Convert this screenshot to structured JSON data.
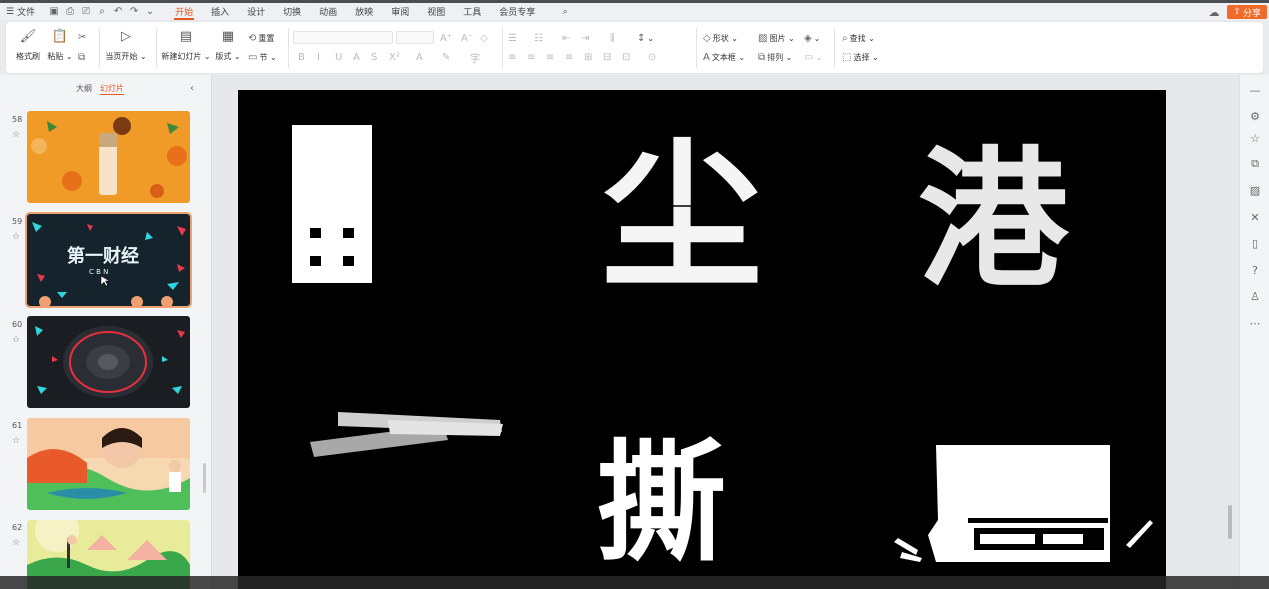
{
  "menubar": {
    "file_label": "文件",
    "tabs": [
      "开始",
      "插入",
      "设计",
      "切换",
      "动画",
      "放映",
      "审阅",
      "视图",
      "工具",
      "会员专享"
    ],
    "share_label": "分享"
  },
  "ribbon": {
    "format_painter": "格式刷",
    "paste": "粘贴",
    "from_current": "当页开始",
    "new_slide": "新建幻灯片",
    "layout": "版式",
    "reset": "重置",
    "section": "节",
    "shape": "形状",
    "picture": "图片",
    "textbox": "文本框",
    "arrange": "排列",
    "find": "查找",
    "select": "选择"
  },
  "left_panel": {
    "tab_outline": "大纲",
    "tab_slides": "幻灯片",
    "slides": [
      {
        "number": "58"
      },
      {
        "number": "59",
        "title_text": "第一财经",
        "sub_text": "C B N"
      },
      {
        "number": "60"
      },
      {
        "number": "61"
      },
      {
        "number": "62"
      }
    ]
  },
  "slide_content": {
    "chars": [
      "尘",
      "港",
      "撕"
    ]
  },
  "colors": {
    "accent": "#e35a1f",
    "share_bg": "#f06a28"
  },
  "icons": [
    "format-painter-icon",
    "paste-icon",
    "scissors-icon",
    "copy-icon",
    "play-icon",
    "new-slide-icon",
    "layout-icon",
    "reset-icon",
    "section-icon",
    "search-icon",
    "cloud-icon"
  ]
}
